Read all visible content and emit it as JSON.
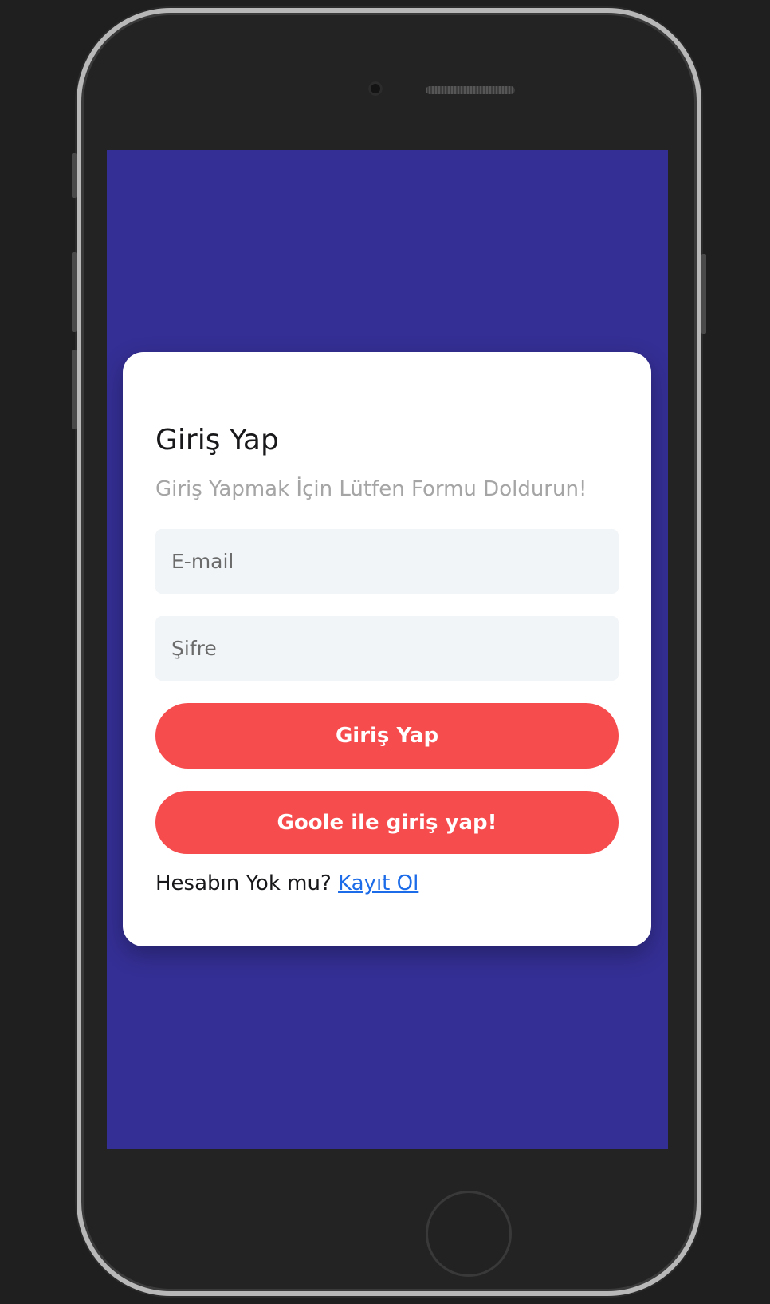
{
  "login_card": {
    "title": "Giriş Yap",
    "subtitle": "Giriş Yapmak İçin Lütfen Formu Doldurun!",
    "email_placeholder": "E-mail",
    "password_placeholder": "Şifre",
    "login_button_label": "Giriş Yap",
    "google_button_label": "Goole ile giriş yap!",
    "no_account_text": "Hesabın Yok mu? ",
    "signup_link_label": "Kayıt Ol"
  },
  "colors": {
    "screen_background": "#342f94",
    "card_background": "#ffffff",
    "primary_button": "#f64c4e",
    "input_background": "#f1f5f8",
    "link": "#1c6be8",
    "subtitle_text": "#a5a5a5",
    "phone_frame": "#232323"
  },
  "icons": [
    "front-camera-icon",
    "speaker-grille-icon",
    "home-button-icon"
  ]
}
